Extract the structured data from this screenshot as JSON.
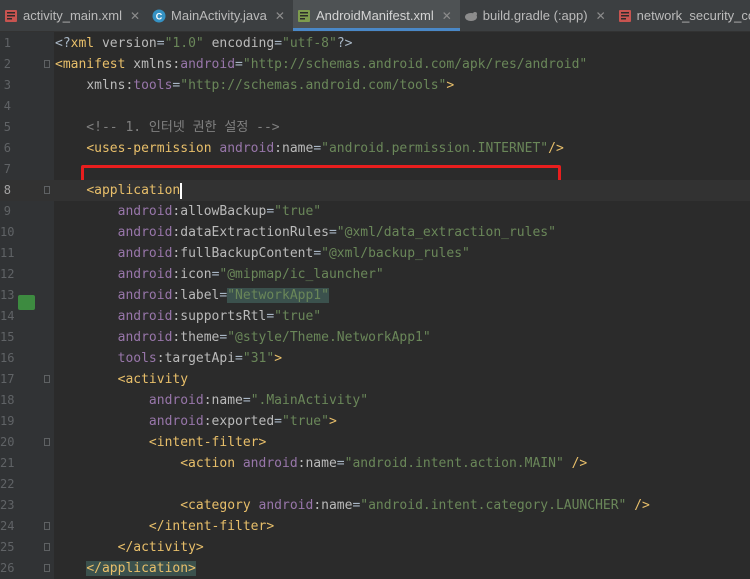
{
  "tabs": [
    {
      "label": "activity_main.xml",
      "icon": "xml-file-icon",
      "color": "#c75450",
      "active": false
    },
    {
      "label": "MainActivity.java",
      "icon": "java-class-icon",
      "color": "#3592c4",
      "active": false
    },
    {
      "label": "AndroidManifest.xml",
      "icon": "manifest-file-icon",
      "color": "#7e9c4e",
      "active": true
    },
    {
      "label": "build.gradle (:app)",
      "icon": "gradle-icon",
      "color": "#8c8c8c",
      "active": false
    },
    {
      "label": "network_security_config.xml",
      "icon": "xml-file-icon",
      "color": "#c75450",
      "active": false
    }
  ],
  "close_glyph": "✕",
  "editor": {
    "current_line": 8,
    "lines": [
      {
        "n": "1",
        "tokens": [
          [
            "pun",
            "<?"
          ],
          [
            "tag",
            "xml "
          ],
          [
            "attr",
            "version"
          ],
          [
            "pun",
            "="
          ],
          [
            "str",
            "\"1.0\""
          ],
          [
            "pun",
            " "
          ],
          [
            "attr",
            "encoding"
          ],
          [
            "pun",
            "="
          ],
          [
            "str",
            "\"utf-8\""
          ],
          [
            "pun",
            "?>"
          ]
        ]
      },
      {
        "n": "2",
        "tokens": [
          [
            "tag",
            "<manifest "
          ],
          [
            "attr",
            "xmlns:"
          ],
          [
            "ns",
            "android"
          ],
          [
            "pun",
            "="
          ],
          [
            "str",
            "\"http://schemas.android.com/apk/res/android\""
          ]
        ]
      },
      {
        "n": "3",
        "tokens": [
          [
            "pun",
            "    "
          ],
          [
            "attr",
            "xmlns:"
          ],
          [
            "ns",
            "tools"
          ],
          [
            "pun",
            "="
          ],
          [
            "str",
            "\"http://schemas.android.com/tools\""
          ],
          [
            "tag",
            ">"
          ]
        ]
      },
      {
        "n": "4",
        "tokens": []
      },
      {
        "n": "5",
        "tokens": [
          [
            "cmt",
            "    <!-- 1. 인터넷 권한 설정 -->"
          ]
        ]
      },
      {
        "n": "6",
        "tokens": [
          [
            "pun",
            "    "
          ],
          [
            "tag",
            "<uses-permission "
          ],
          [
            "ns",
            "android"
          ],
          [
            "attr",
            ":name"
          ],
          [
            "pun",
            "="
          ],
          [
            "str",
            "\"android.permission.INTERNET\""
          ],
          [
            "tag",
            "/>"
          ]
        ]
      },
      {
        "n": "7",
        "tokens": []
      },
      {
        "n": "8",
        "tokens": [
          [
            "pun",
            "    "
          ],
          [
            "tag",
            "<application"
          ]
        ]
      },
      {
        "n": "9",
        "tokens": [
          [
            "pun",
            "        "
          ],
          [
            "ns",
            "android"
          ],
          [
            "attr",
            ":allowBackup"
          ],
          [
            "pun",
            "="
          ],
          [
            "str",
            "\"true\""
          ]
        ]
      },
      {
        "n": "10",
        "tokens": [
          [
            "pun",
            "        "
          ],
          [
            "ns",
            "android"
          ],
          [
            "attr",
            ":dataExtractionRules"
          ],
          [
            "pun",
            "="
          ],
          [
            "str",
            "\"@xml/data_extraction_rules\""
          ]
        ]
      },
      {
        "n": "11",
        "tokens": [
          [
            "pun",
            "        "
          ],
          [
            "ns",
            "android"
          ],
          [
            "attr",
            ":fullBackupContent"
          ],
          [
            "pun",
            "="
          ],
          [
            "str",
            "\"@xml/backup_rules\""
          ]
        ]
      },
      {
        "n": "12",
        "tokens": [
          [
            "pun",
            "        "
          ],
          [
            "ns",
            "android"
          ],
          [
            "attr",
            ":icon"
          ],
          [
            "pun",
            "="
          ],
          [
            "str",
            "\"@mipmap/ic_launcher\""
          ]
        ]
      },
      {
        "n": "13",
        "tokens": [
          [
            "pun",
            "        "
          ],
          [
            "ns",
            "android"
          ],
          [
            "attr",
            ":label"
          ],
          [
            "pun",
            "="
          ],
          [
            "strhl",
            "\"NetworkApp1\""
          ]
        ]
      },
      {
        "n": "14",
        "tokens": [
          [
            "pun",
            "        "
          ],
          [
            "ns",
            "android"
          ],
          [
            "attr",
            ":supportsRtl"
          ],
          [
            "pun",
            "="
          ],
          [
            "str",
            "\"true\""
          ]
        ]
      },
      {
        "n": "15",
        "tokens": [
          [
            "pun",
            "        "
          ],
          [
            "ns",
            "android"
          ],
          [
            "attr",
            ":theme"
          ],
          [
            "pun",
            "="
          ],
          [
            "str",
            "\"@style/Theme.NetworkApp1\""
          ]
        ]
      },
      {
        "n": "16",
        "tokens": [
          [
            "pun",
            "        "
          ],
          [
            "ns",
            "tools"
          ],
          [
            "attr",
            ":targetApi"
          ],
          [
            "pun",
            "="
          ],
          [
            "str",
            "\"31\""
          ],
          [
            "tag",
            ">"
          ]
        ]
      },
      {
        "n": "17",
        "tokens": [
          [
            "pun",
            "        "
          ],
          [
            "tag",
            "<activity"
          ]
        ]
      },
      {
        "n": "18",
        "tokens": [
          [
            "pun",
            "            "
          ],
          [
            "ns",
            "android"
          ],
          [
            "attr",
            ":name"
          ],
          [
            "pun",
            "="
          ],
          [
            "str",
            "\".MainActivity\""
          ]
        ]
      },
      {
        "n": "19",
        "tokens": [
          [
            "pun",
            "            "
          ],
          [
            "ns",
            "android"
          ],
          [
            "attr",
            ":exported"
          ],
          [
            "pun",
            "="
          ],
          [
            "str",
            "\"true\""
          ],
          [
            "tag",
            ">"
          ]
        ]
      },
      {
        "n": "20",
        "tokens": [
          [
            "pun",
            "            "
          ],
          [
            "tag",
            "<intent-filter>"
          ]
        ]
      },
      {
        "n": "21",
        "tokens": [
          [
            "pun",
            "                "
          ],
          [
            "tag",
            "<action "
          ],
          [
            "ns",
            "android"
          ],
          [
            "attr",
            ":name"
          ],
          [
            "pun",
            "="
          ],
          [
            "str",
            "\"android.intent.action.MAIN\""
          ],
          [
            "pun",
            " "
          ],
          [
            "tag",
            "/>"
          ]
        ]
      },
      {
        "n": "22",
        "tokens": []
      },
      {
        "n": "23",
        "tokens": [
          [
            "pun",
            "                "
          ],
          [
            "tag",
            "<category "
          ],
          [
            "ns",
            "android"
          ],
          [
            "attr",
            ":name"
          ],
          [
            "pun",
            "="
          ],
          [
            "str",
            "\"android.intent.category.LAUNCHER\""
          ],
          [
            "pun",
            " "
          ],
          [
            "tag",
            "/>"
          ]
        ]
      },
      {
        "n": "24",
        "tokens": [
          [
            "pun",
            "            "
          ],
          [
            "tag",
            "</intent-filter>"
          ]
        ]
      },
      {
        "n": "25",
        "tokens": [
          [
            "pun",
            "        "
          ],
          [
            "tag",
            "</activity>"
          ]
        ]
      },
      {
        "n": "26",
        "tokens": [
          [
            "pun",
            "    "
          ],
          [
            "taghl",
            "</application>"
          ]
        ]
      }
    ]
  }
}
